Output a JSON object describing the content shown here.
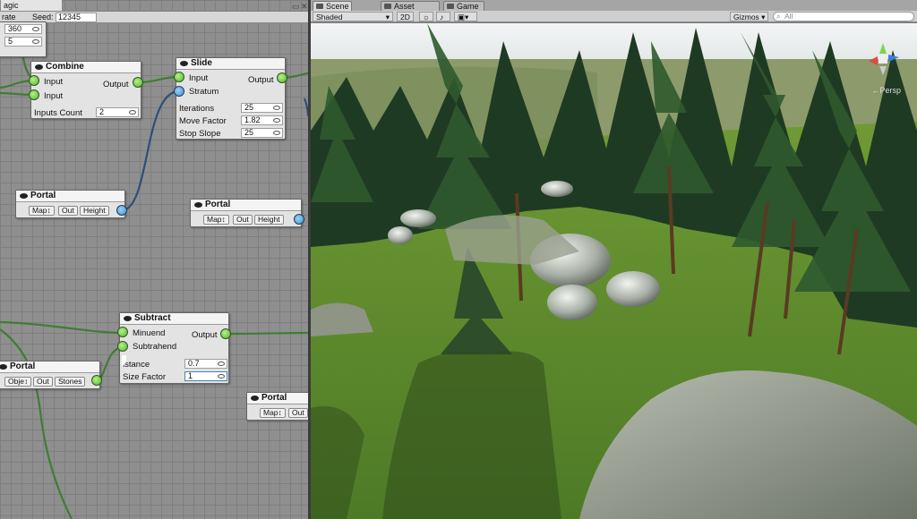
{
  "graph": {
    "window_title": "agic",
    "generate_label": "rate",
    "seed_label": "Seed:",
    "seed_value": "12345",
    "partial_values": [
      "360",
      "5"
    ],
    "nodes": {
      "combine": {
        "title": "Combine",
        "input1": "Input",
        "input2": "Input",
        "output": "Output",
        "inputs_count_label": "Inputs Count",
        "inputs_count_value": "2"
      },
      "slide": {
        "title": "Slide",
        "input": "Input",
        "stratum": "Stratum",
        "output": "Output",
        "iterations_label": "Iterations",
        "iterations_value": "25",
        "move_factor_label": "Move Factor",
        "move_factor_value": "1.82",
        "stop_slope_label": "Stop Slope",
        "stop_slope_value": "25"
      },
      "portal1": {
        "title": "Portal",
        "btn1": "Map↕",
        "btn2": "Out",
        "btn3": "Height"
      },
      "portal2": {
        "title": "Portal",
        "btn1": "Map↕",
        "btn2": "Out",
        "btn3": "Height"
      },
      "subtract": {
        "title": "Subtract",
        "minuend": "Minuend",
        "subtrahend": "Subtrahend",
        "output": "Output",
        "distance_label": "istance",
        "distance_value": "0.7",
        "size_factor_label": "Size Factor",
        "size_factor_value": "1"
      },
      "portal3": {
        "title": "Portal",
        "btn1": "Obje↕",
        "btn2": "Out",
        "btn3": "Stones"
      },
      "portal4": {
        "title": "Portal",
        "btn1": "Map↕",
        "btn2": "Out"
      }
    }
  },
  "scene_panel": {
    "tabs": [
      {
        "label": "Scene",
        "active": true
      },
      {
        "label": "Asset Store",
        "active": false
      },
      {
        "label": "Game",
        "active": false
      }
    ],
    "toolbar": {
      "shading_mode": "Shaded",
      "mode_2d": "2D",
      "gizmos": "Gizmos",
      "search_placeholder": "All"
    },
    "gizmo_label": "←Persp"
  },
  "colors": {
    "port_green": "#4fb32b",
    "port_blue": "#3a8fcf",
    "wire_green": "#3f7d32",
    "wire_blue": "#2d4f78"
  }
}
